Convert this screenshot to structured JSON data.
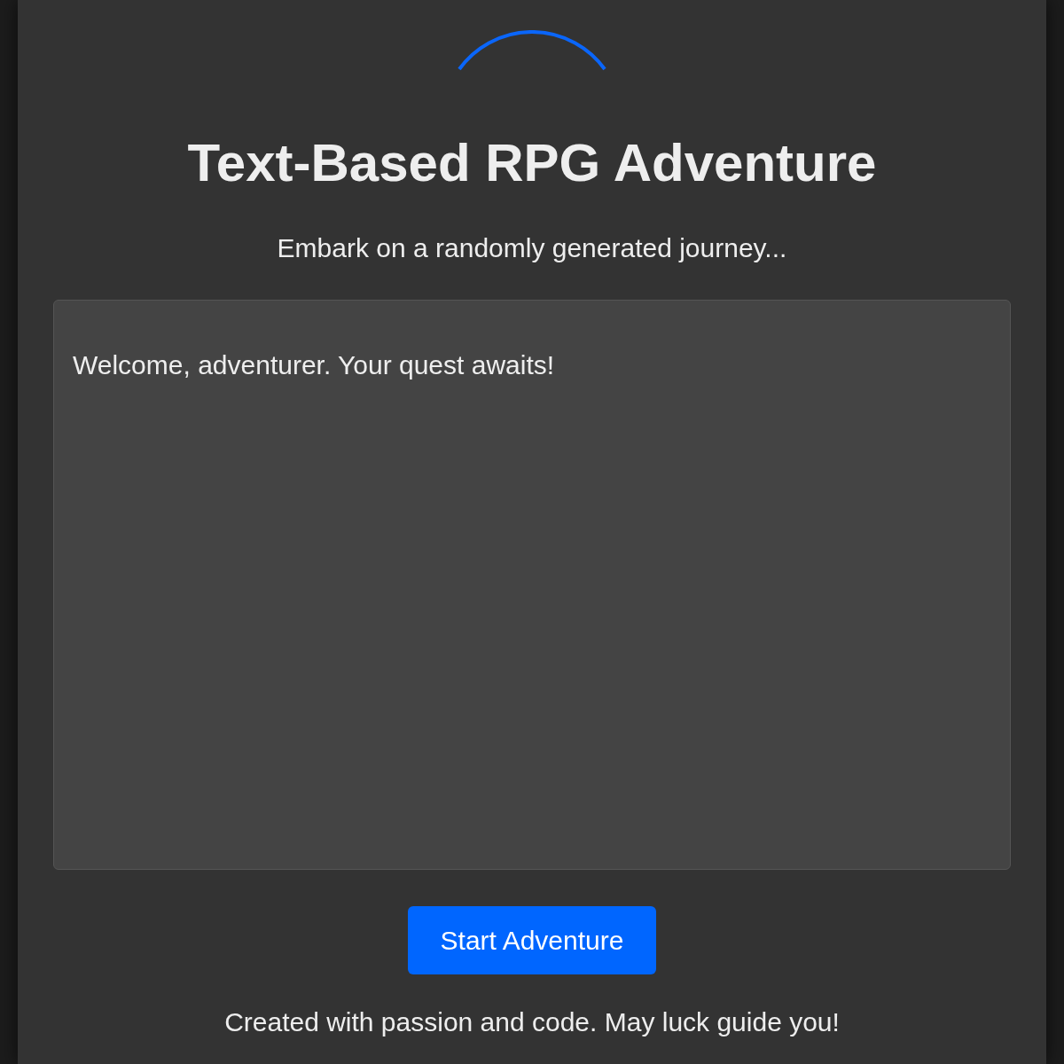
{
  "header": {
    "title": "Text-Based RPG Adventure",
    "subtitle": "Embark on a randomly generated journey..."
  },
  "story": {
    "text": "Welcome, adventurer. Your quest awaits!"
  },
  "start_button": {
    "label": "Start Adventure"
  },
  "footer": {
    "text": "Created with passion and code. May luck guide you!"
  }
}
